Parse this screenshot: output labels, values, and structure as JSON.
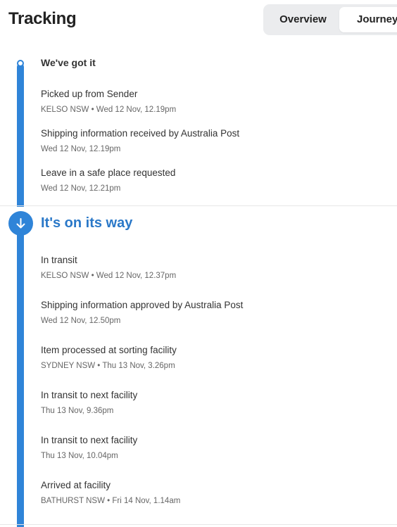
{
  "header": {
    "title": "Tracking",
    "tabs": [
      {
        "label": "Overview",
        "selected": false
      },
      {
        "label": "Journey",
        "selected": true
      }
    ]
  },
  "timeline": {
    "color": "#2f84d8",
    "sections": [
      {
        "title": "We've got it",
        "events": [
          {
            "title": "Picked up from Sender",
            "meta": "KELSO NSW • Wed 12 Nov, 12.19pm"
          },
          {
            "title": "Shipping information received by Australia Post",
            "meta": "Wed 12 Nov, 12.19pm"
          },
          {
            "title": "Leave in a safe place requested",
            "meta": "Wed 12 Nov, 12.21pm"
          }
        ]
      },
      {
        "title": "It's on its way",
        "icon": "arrow-down-icon",
        "events": [
          {
            "title": "In transit",
            "meta": "KELSO NSW • Wed 12 Nov, 12.37pm"
          },
          {
            "title": "Shipping information approved by Australia Post",
            "meta": "Wed 12 Nov, 12.50pm"
          },
          {
            "title": "Item processed at sorting facility",
            "meta": "SYDNEY NSW • Thu 13 Nov, 3.26pm"
          },
          {
            "title": "In transit to next facility",
            "meta": "Thu 13 Nov, 9.36pm"
          },
          {
            "title": "In transit to next facility",
            "meta": "Thu 13 Nov, 10.04pm"
          },
          {
            "title": "Arrived at facility",
            "meta": "BATHURST NSW • Fri 14 Nov, 1.14am"
          }
        ]
      }
    ]
  }
}
